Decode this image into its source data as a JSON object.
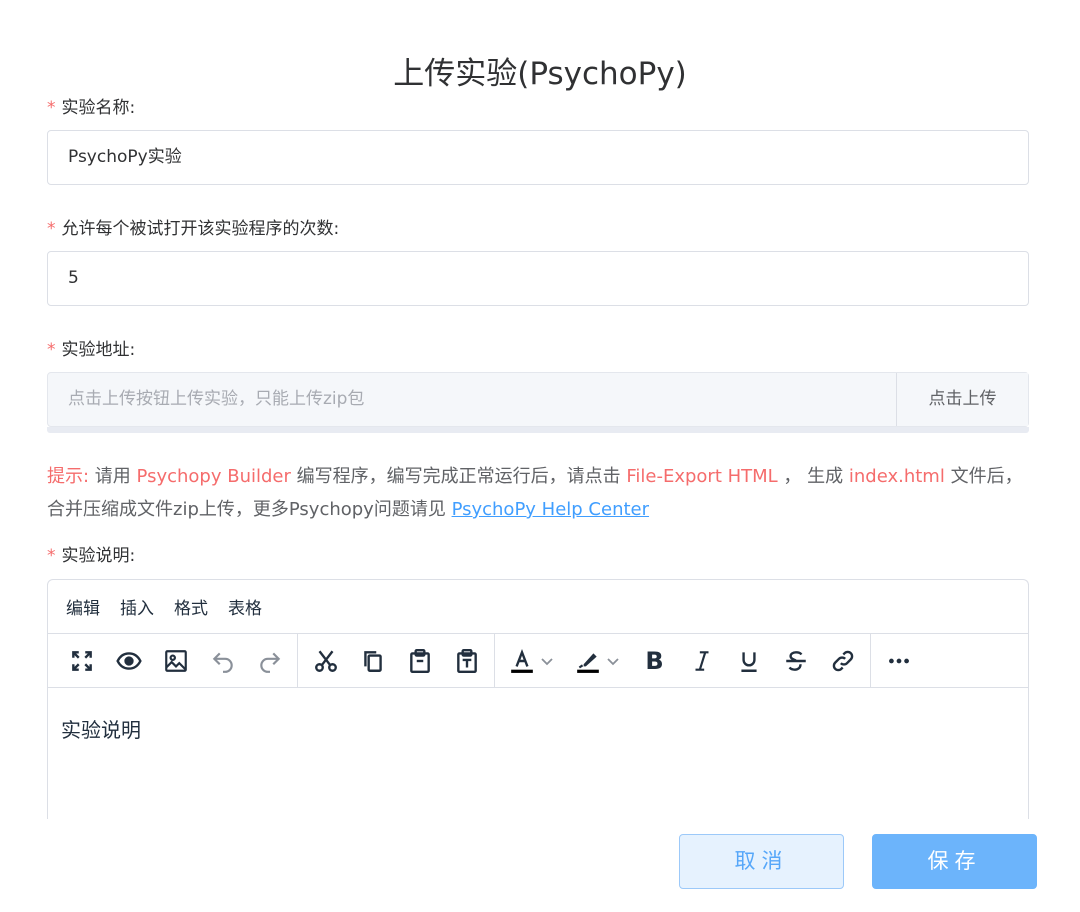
{
  "title": "上传实验(PsychoPy)",
  "form": {
    "required_mark": "*",
    "name": {
      "label": "实验名称:",
      "value": "PsychoPy实验"
    },
    "count": {
      "label": "允许每个被试打开该实验程序的次数:",
      "value": "5"
    },
    "address": {
      "label": "实验地址:",
      "placeholder": "点击上传按钮上传实验，只能上传zip包",
      "upload_label": "点击上传"
    },
    "tip": {
      "prefix": "提示:",
      "t1": " 请用 ",
      "builder": "Psychopy Builder",
      "t2": " 编写程序，编写完成正常运行后，请点击 ",
      "export": "File-Export HTML",
      "t3": " ， 生成 ",
      "index": "index.html",
      "t4": " 文件后，合并压缩成文件zip上传，更多Psychopy问题请见 ",
      "help_link": "PsychoPy Help Center"
    },
    "desc": {
      "label": "实验说明:"
    }
  },
  "editor": {
    "menu": [
      "编辑",
      "插入",
      "格式",
      "表格"
    ],
    "content": "实验说明",
    "bold_glyph": "B",
    "icons": [
      "fullscreen-icon",
      "preview-icon",
      "image-icon",
      "undo-icon",
      "redo-icon",
      "cut-icon",
      "copy-icon",
      "paste-icon",
      "paste-text-icon",
      "text-color-icon",
      "highlight-icon",
      "bold-icon",
      "italic-icon",
      "underline-icon",
      "strikethrough-icon",
      "link-icon",
      "more-icon"
    ]
  },
  "actions": {
    "cancel": "取消",
    "save": "保存"
  },
  "colors": {
    "required": "#f56c6c",
    "link": "#409eff",
    "primary": "#6cb4fb"
  }
}
